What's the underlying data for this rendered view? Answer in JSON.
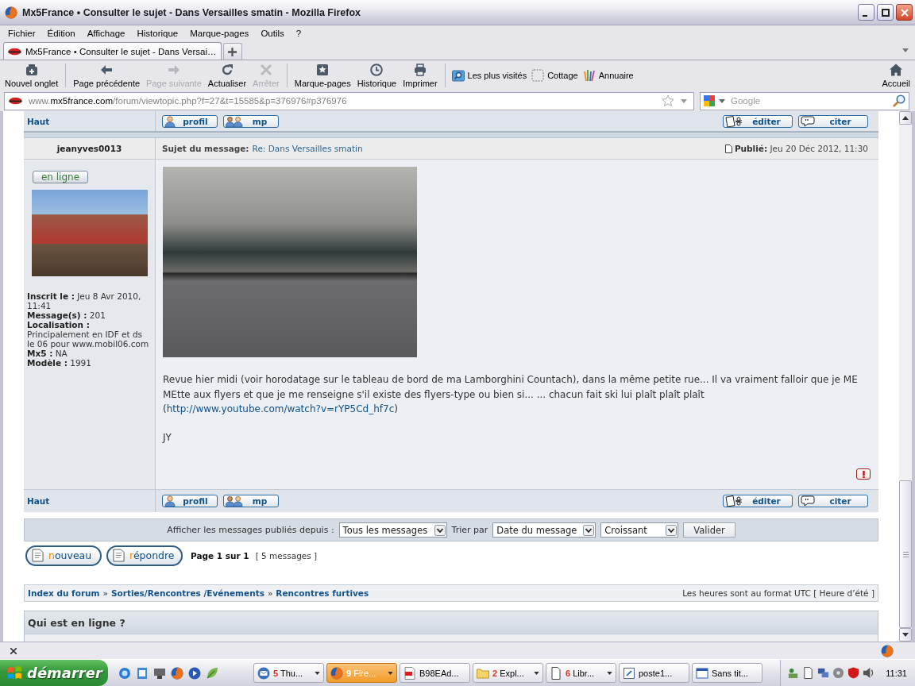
{
  "window": {
    "title": "Mx5France • Consulter le sujet - Dans Versailles smatin - Mozilla Firefox"
  },
  "menu": [
    "Fichier",
    "Édition",
    "Affichage",
    "Historique",
    "Marque-pages",
    "Outils",
    "?"
  ],
  "tabs": [
    {
      "label": "Mx5France • Consulter le sujet - Dans Versai…",
      "selected": true
    }
  ],
  "toolbar": [
    {
      "label": "Nouvel onglet",
      "disabled": false
    },
    {
      "label": "Page précédente",
      "disabled": false
    },
    {
      "label": "Page suivante",
      "disabled": true
    },
    {
      "label": "Actualiser",
      "disabled": false
    },
    {
      "label": "Arrêter",
      "disabled": true
    },
    {
      "label": "Marque-pages",
      "disabled": false
    },
    {
      "label": "Historique",
      "disabled": false
    },
    {
      "label": "Imprimer",
      "disabled": false
    }
  ],
  "bookmarks": [
    "Les plus visités",
    "Cottage",
    "Annuaire"
  ],
  "home": {
    "label": "Accueil"
  },
  "address": {
    "prefix": "www.",
    "domain": "mx5france.com",
    "path": "/forum/viewtopic.php?f=27&t=15585&p=376976#p376976"
  },
  "search": {
    "placeholder": "Google"
  },
  "post": {
    "top_bar": {
      "back_link": "Haut",
      "buttons": [
        "profil",
        "mp",
        "éditer",
        "citer"
      ]
    },
    "author": "jeanyves0013",
    "subject_label": "Sujet du message:",
    "subject": "Re: Dans Versailles smatin",
    "published": "**Publié:** Jeu 20 Déc 2012, 11:30",
    "status": {
      "label": "en ligne",
      "online": true
    },
    "profile": [
      "**Inscrit le :** Jeu 8 Avr 2010, 11:41",
      "**Message(s) :** 201",
      "**Localisation :** Principalement en IDF et ds le 06 pour www.mobil06.com",
      "**Mx5 :** NA",
      "**Modèle :** 1991"
    ],
    "body": {
      "text": "Revue hier midi (voir horodatage sur le tableau de bord de ma Lamborghini Countach), dans la même petite rue... Il va vraiment falloir que je ME MEtte aux flyers et que je me renseigne s'il existe des flyers-type ou bien si... ... chacun fait ski lui plaît plaît plaît (",
      "link": "http://www.youtube.com/watch?v=rYP5Cd_hf7c",
      "after": ")"
    },
    "signature": "JY",
    "bottom_bar": {
      "back_link": "Haut",
      "buttons": [
        "profil",
        "mp",
        "éditer",
        "citer"
      ]
    }
  },
  "sort_bar": {
    "label": "Afficher les messages publiés depuis :",
    "days": "Tous les messages",
    "sort_label": "Trier par",
    "sort_key": "Date du message",
    "direction": "Croissant",
    "submit": "Valider"
  },
  "actions": [
    "nouveau",
    "répondre"
  ],
  "pagination": {
    "pages": "Page 1 sur 1",
    "count": "[ 5 messages ]"
  },
  "breadcrumbs": {
    "items": [
      {
        "kind": "link",
        "text": "Index du forum"
      },
      {
        "kind": "separator",
        "text": "»"
      },
      {
        "kind": "link",
        "text": "Sorties/Rencontres /Evénements"
      },
      {
        "kind": "separator",
        "text": "»"
      },
      {
        "kind": "link",
        "text": "Rencontres furtives"
      }
    ],
    "timezone": "Les heures sont au format UTC [ Heure d’été ]"
  },
  "who_online": {
    "title": "Qui est en ligne ?"
  },
  "taskbar": {
    "start": "démarrer",
    "tasks": [
      {
        "count": "5",
        "label": "Thu...",
        "grouped": true,
        "selected": false
      },
      {
        "count": "9",
        "label": "Fire...",
        "grouped": true,
        "selected": true
      },
      {
        "label": "B98EAd...",
        "grouped": false,
        "selected": false
      },
      {
        "count": "2",
        "label": "Expl...",
        "grouped": true,
        "selected": false
      },
      {
        "count": "6",
        "label": "Libr...",
        "grouped": true,
        "selected": false
      },
      {
        "label": "poste1...",
        "grouped": false,
        "selected": false
      },
      {
        "label": "Sans tit...",
        "grouped": false,
        "selected": false
      }
    ],
    "clock": "11:31"
  }
}
